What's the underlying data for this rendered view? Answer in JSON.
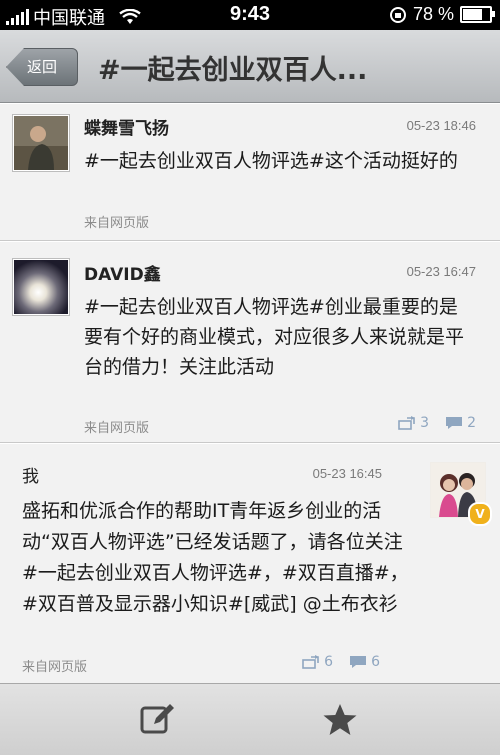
{
  "status_bar": {
    "carrier": "中国联通",
    "time": "9:43",
    "battery_percent": "78 %",
    "battery_level": 0.78
  },
  "nav": {
    "back_label": "返回",
    "title": "#一起去创业双百人..."
  },
  "posts": [
    {
      "author": "蝶舞雪飞扬",
      "time": "05-23 18:46",
      "content": "#一起去创业双百人物评选#这个活动挺好的",
      "source": "来自网页版"
    },
    {
      "author": "DAVID鑫",
      "time": "05-23 16:47",
      "content": "#一起去创业双百人物评选#创业最重要的是要有个好的商业模式，对应很多人来说就是平台的借力！关注此活动",
      "source": "来自网页版",
      "reposts": "3",
      "comments": "2"
    },
    {
      "author": "我",
      "time": "05-23 16:45",
      "content": "盛拓和优派合作的帮助IT青年返乡创业的活动“双百人物评选”已经发话题了，请各位关注#一起去创业双百人物评选#，#双百直播#，#双百普及显示器小知识#[威武] @土布衣衫",
      "source": "来自网页版",
      "reposts": "6",
      "comments": "6",
      "badge": "V"
    }
  ],
  "tabbar": {
    "compose_icon": "compose-icon",
    "favorite_icon": "star-icon"
  }
}
